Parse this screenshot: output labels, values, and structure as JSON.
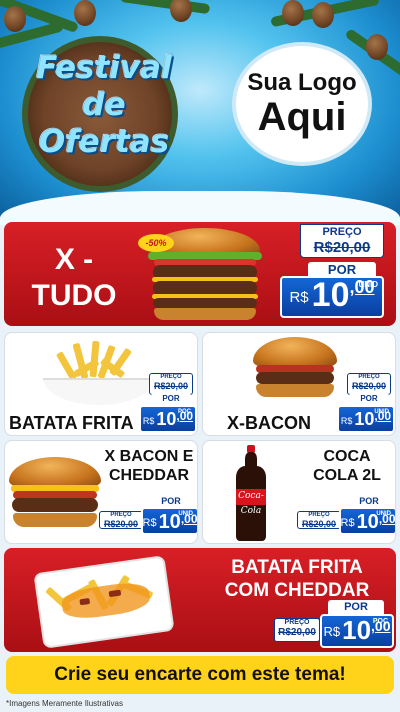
{
  "header": {
    "title_lines": [
      "Festival",
      "de",
      "Ofertas"
    ],
    "logo_lines": [
      "Sua Logo",
      "Aqui"
    ]
  },
  "featured": {
    "name_lines": [
      "X -",
      "TUDO"
    ],
    "discount_badge": "-50%",
    "old_label": "PREÇO",
    "old_price": "R$20,00",
    "por": "POR",
    "currency": "R$",
    "price_int": "10",
    "price_dec": ",00",
    "unit": "UNID"
  },
  "products": [
    {
      "name": "BATATA FRITA",
      "old_label": "PREÇO",
      "old_price": "R$20,00",
      "por": "POR",
      "currency": "R$",
      "price_int": "10",
      "price_dec": ",00",
      "unit": "POÇ"
    },
    {
      "name": "X-BACON",
      "old_label": "PREÇO",
      "old_price": "R$20,00",
      "por": "POR",
      "currency": "R$",
      "price_int": "10",
      "price_dec": ",00",
      "unit": "UNID"
    },
    {
      "name_lines": [
        "X BACON E",
        "CHEDDAR"
      ],
      "old_label": "PREÇO",
      "old_price": "R$20,00",
      "por": "POR",
      "currency": "R$",
      "price_int": "10",
      "price_dec": ",00",
      "unit": "UNID"
    },
    {
      "name_lines": [
        "COCA",
        "COLA 2L"
      ],
      "old_label": "PREÇO",
      "old_price": "R$20,00",
      "por": "POR",
      "currency": "R$",
      "price_int": "10",
      "price_dec": ",00",
      "unit": "UNID",
      "bottle_label": "Coca-Cola"
    }
  ],
  "bottom_featured": {
    "name_lines": [
      "BATATA FRITA",
      "COM CHEDDAR"
    ],
    "old_label": "PREÇO",
    "old_price": "R$20,00",
    "por": "POR",
    "currency": "R$",
    "price_int": "10",
    "price_dec": ",00",
    "unit": "POÇ"
  },
  "footer": {
    "banner": "Crie seu encarte com este tema!",
    "disclaimer": "*Imagens Meramente Ilustrativas"
  },
  "colors": {
    "red": "#d81f26",
    "blue": "#0a3fa0",
    "yellow": "#ffd31a"
  }
}
